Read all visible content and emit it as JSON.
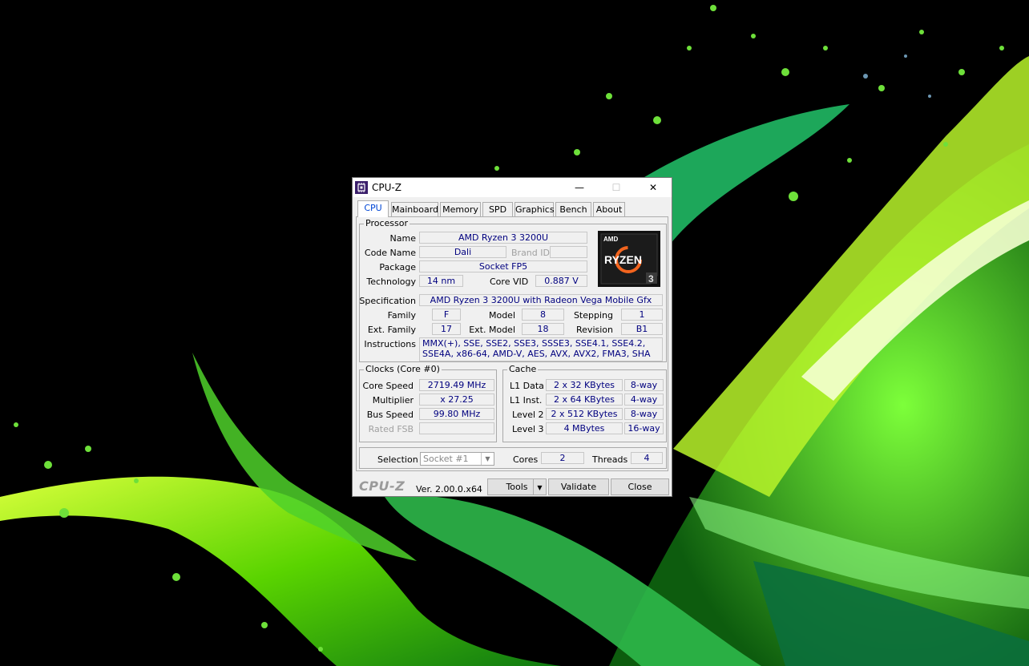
{
  "window": {
    "title": "CPU-Z",
    "minimize": "—",
    "maximize": "☐",
    "close": "✕"
  },
  "tabs": [
    "CPU",
    "Mainboard",
    "Memory",
    "SPD",
    "Graphics",
    "Bench",
    "About"
  ],
  "active_tab": "CPU",
  "processor": {
    "group_title": "Processor",
    "name_label": "Name",
    "name": "AMD Ryzen 3 3200U",
    "code_name_label": "Code Name",
    "code_name": "Dali",
    "brand_id_label": "Brand ID",
    "brand_id": "",
    "package_label": "Package",
    "package": "Socket FP5",
    "technology_label": "Technology",
    "technology": "14 nm",
    "core_vid_label": "Core VID",
    "core_vid": "0.887 V",
    "specification_label": "Specification",
    "specification": "AMD Ryzen 3 3200U with Radeon Vega Mobile Gfx",
    "family_label": "Family",
    "family": "F",
    "model_label": "Model",
    "model": "8",
    "stepping_label": "Stepping",
    "stepping": "1",
    "ext_family_label": "Ext. Family",
    "ext_family": "17",
    "ext_model_label": "Ext. Model",
    "ext_model": "18",
    "revision_label": "Revision",
    "revision": "B1",
    "instructions_label": "Instructions",
    "instructions": "MMX(+), SSE, SSE2, SSE3, SSSE3, SSE4.1, SSE4.2, SSE4A, x86-64, AMD-V, AES, AVX, AVX2, FMA3, SHA"
  },
  "logo": {
    "brand": "AMD",
    "line": "RYZEN",
    "tier": "3"
  },
  "clocks": {
    "group_title": "Clocks (Core #0)",
    "core_speed_label": "Core Speed",
    "core_speed": "2719.49 MHz",
    "multiplier_label": "Multiplier",
    "multiplier": "x 27.25",
    "bus_speed_label": "Bus Speed",
    "bus_speed": "99.80 MHz",
    "rated_fsb_label": "Rated FSB",
    "rated_fsb": ""
  },
  "cache": {
    "group_title": "Cache",
    "l1_data_label": "L1 Data",
    "l1_data": "2 x 32 KBytes",
    "l1_data_way": "8-way",
    "l1_inst_label": "L1 Inst.",
    "l1_inst": "2 x 64 KBytes",
    "l1_inst_way": "4-way",
    "level2_label": "Level 2",
    "level2": "2 x 512 KBytes",
    "level2_way": "8-way",
    "level3_label": "Level 3",
    "level3": "4 MBytes",
    "level3_way": "16-way"
  },
  "selection": {
    "label": "Selection",
    "value": "Socket #1",
    "cores_label": "Cores",
    "cores": "2",
    "threads_label": "Threads",
    "threads": "4"
  },
  "footer": {
    "brand": "CPU-Z",
    "version": "Ver. 2.00.0.x64",
    "tools": "Tools",
    "tools_arrow": "▼",
    "validate": "Validate",
    "close": "Close"
  }
}
